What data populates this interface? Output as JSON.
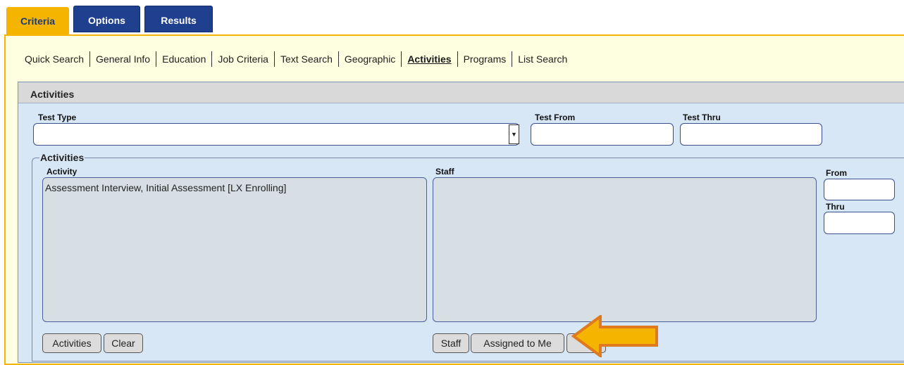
{
  "tabs": {
    "criteria": "Criteria",
    "options": "Options",
    "results": "Results"
  },
  "subnav": {
    "items": [
      "Quick Search",
      "General Info",
      "Education",
      "Job Criteria",
      "Text Search",
      "Geographic",
      "Activities",
      "Programs",
      "List Search"
    ],
    "active": "Activities"
  },
  "panel": {
    "title": "Activities",
    "test_type_label": "Test Type",
    "test_type_value": "",
    "test_from_label": "Test From",
    "test_from_value": "",
    "test_thru_label": "Test Thru",
    "test_thru_value": "",
    "activities_group": {
      "legend": "Activities",
      "activity_label": "Activity",
      "activity_items": [
        "Assessment Interview, Initial Assessment [LX Enrolling]"
      ],
      "staff_label": "Staff",
      "staff_items": [],
      "from_label": "From",
      "from_value": "",
      "thru_label": "Thru",
      "thru_value": "",
      "buttons": {
        "activities": "Activities",
        "clear": "Clear",
        "staff": "Staff",
        "assigned_to_me": "Assigned to Me"
      }
    }
  },
  "colors": {
    "accent_orange": "#f5b400",
    "nav_blue": "#1f3f8f",
    "panel_bg": "#d7e7f6",
    "page_bg": "#fefee0"
  },
  "annotation": {
    "icon": "arrow-left-icon",
    "color": "#f5a623"
  }
}
